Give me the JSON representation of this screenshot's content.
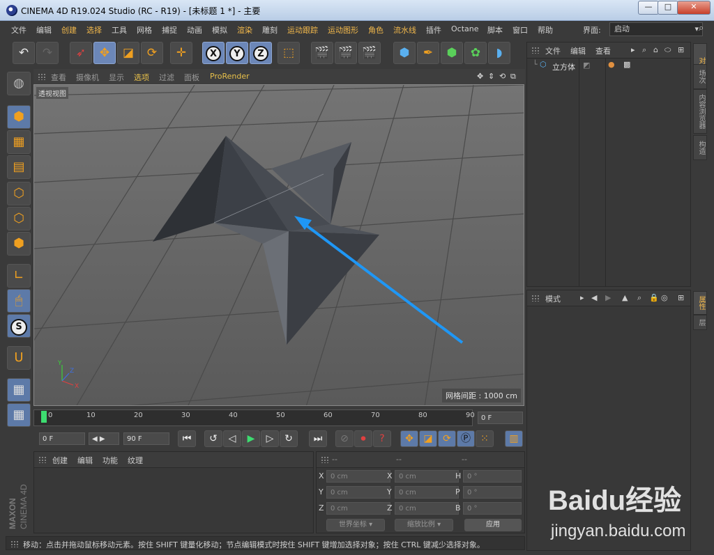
{
  "window": {
    "title": "CINEMA 4D R19.024 Studio (RC - R19) - [未标题 1 *] - 主要",
    "controls": {
      "minimize": "—",
      "maximize": "□",
      "close": "✕"
    }
  },
  "menubar": {
    "items": [
      "文件",
      "编辑",
      "创建",
      "选择",
      "工具",
      "网格",
      "捕捉",
      "动画",
      "模拟",
      "渲染",
      "雕刻",
      "运动跟踪",
      "运动图形",
      "角色",
      "流水线",
      "插件",
      "Octane",
      "脚本",
      "窗口",
      "帮助"
    ],
    "layout_label": "界面:",
    "layout_value": "启动"
  },
  "toolbar": {
    "axis_x": "X",
    "axis_y": "Y",
    "axis_z": "Z"
  },
  "viewport": {
    "menu": [
      "查看",
      "摄像机",
      "显示",
      "选项",
      "过滤",
      "面板",
      "ProRender"
    ],
    "camera_label": "透视视图",
    "grid_info": "网格间距 : 1000 cm",
    "axes": {
      "x": "X",
      "y": "Y",
      "z": "Z"
    }
  },
  "object_manager": {
    "menu": [
      "文件",
      "编辑",
      "查看"
    ],
    "objects": [
      {
        "name": "立方体"
      }
    ],
    "side_tabs": [
      "对象",
      "场次",
      "内容浏览器",
      "构造"
    ]
  },
  "attribute_manager": {
    "menu": [
      "模式"
    ],
    "side_tabs": [
      "属性",
      "层"
    ]
  },
  "timeline": {
    "ticks": [
      "0",
      "10",
      "20",
      "30",
      "40",
      "50",
      "60",
      "70",
      "80",
      "90"
    ],
    "current_frame": "0 F",
    "start_frame": "0 F",
    "end_frame": "90 F"
  },
  "material_manager": {
    "menu": [
      "创建",
      "编辑",
      "功能",
      "纹理"
    ]
  },
  "coordinates": {
    "headers": [
      "--",
      "--",
      "--"
    ],
    "rows": [
      {
        "l1": "X",
        "v1": "0 cm",
        "l2": "X",
        "v2": "0 cm",
        "l3": "H",
        "v3": "0 °"
      },
      {
        "l1": "Y",
        "v1": "0 cm",
        "l2": "Y",
        "v2": "0 cm",
        "l3": "P",
        "v3": "0 °"
      },
      {
        "l1": "Z",
        "v1": "0 cm",
        "l2": "Z",
        "v2": "0 cm",
        "l3": "B",
        "v3": "0 °"
      }
    ],
    "coord_system": "世界坐标",
    "scale_mode": "缩放比例",
    "apply": "应用"
  },
  "status": {
    "text": "移动：点击并拖动鼠标移动元素。按住 SHIFT 键量化移动；节点编辑模式时按住 SHIFT 键增加选择对象；按住 CTRL 键减少选择对象。"
  },
  "branding": {
    "maxon": "MAXON",
    "cinema": "CINEMA 4D",
    "watermark_main": "Baidu经验",
    "watermark_sub": "jingyan.baidu.com"
  },
  "colors": {
    "accent": "#f2b84b",
    "selection": "#6c87b8",
    "arrow": "#1f97f5",
    "playhead": "#3ddc70"
  }
}
